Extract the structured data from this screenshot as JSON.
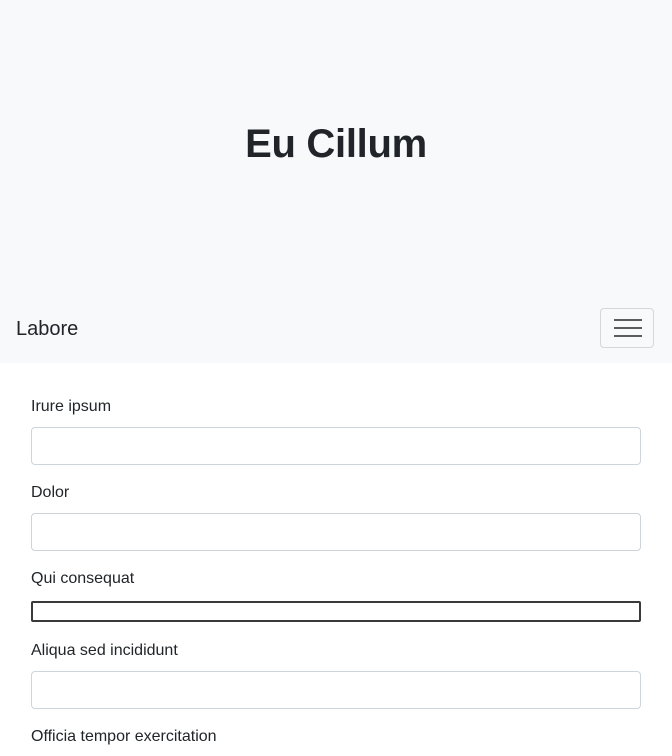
{
  "hero": {
    "title": "Eu Cillum"
  },
  "navbar": {
    "brand": "Labore",
    "toggler_icon": "hamburger-menu-icon"
  },
  "form": {
    "fields": [
      {
        "label": "Irure ipsum",
        "value": ""
      },
      {
        "label": "Dolor",
        "value": ""
      },
      {
        "label": "Qui consequat",
        "value": ""
      },
      {
        "label": "Aliqua sed incididunt",
        "value": ""
      },
      {
        "label": "Officia tempor exercitation",
        "value": ""
      }
    ]
  },
  "colors": {
    "hero_bg": "#f8f9fa",
    "text": "#212529",
    "input_border": "#ced4da"
  }
}
